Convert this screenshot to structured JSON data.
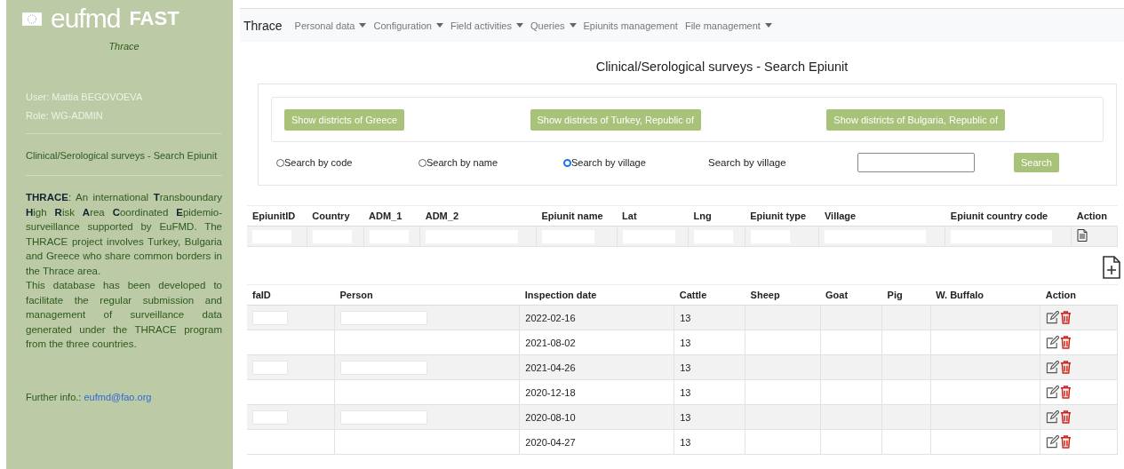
{
  "sidebar": {
    "logo_text": "eufmd",
    "logo_fast": "FAST",
    "subtitle": "Thrace",
    "user": "User: Mattia BEGOVOEVA",
    "role": "Role: WG-ADMIN",
    "current_page": "Clinical/Serological surveys - Search Epiunit",
    "about": [
      "**THRACE**: An international **T**ransboundary **H**igh **R**isk **A**rea **C**oordinated **E**pidemio-surveillance supported by EuFMD. The THRACE project involves Turkey, Bulgaria and Greece who share common borders in the Thrace area.",
      "This database has been developed to facilitate the regular submission and management of surveillance data generated under the THRACE program from the three countries."
    ],
    "further_label": "Further info.:",
    "further_link": "eufmd@fao.org"
  },
  "navbar": {
    "brand": "Thrace",
    "items": [
      {
        "label": "Personal data",
        "dropdown": true
      },
      {
        "label": "Configuration",
        "dropdown": true
      },
      {
        "label": "Field activities",
        "dropdown": true
      },
      {
        "label": "Queries",
        "dropdown": true
      },
      {
        "label": "Epiunits management",
        "dropdown": false
      },
      {
        "label": "File management",
        "dropdown": true
      }
    ]
  },
  "page_title": "Clinical/Serological surveys - Search Epiunit",
  "district_buttons": [
    "Show districts of Greece",
    "Show districts of Turkey, Republic of",
    "Show districts of Bulgaria, Republic of"
  ],
  "search_modes": [
    {
      "label": "Search by code",
      "selected": false
    },
    {
      "label": "Search by name",
      "selected": false
    },
    {
      "label": "Search by village",
      "selected": true
    }
  ],
  "search_label": "Search by village",
  "search_button": "Search",
  "epiunit_table": {
    "columns": [
      "EpiunitID",
      "Country",
      "ADM_1",
      "ADM_2",
      "Epiunit name",
      "Lat",
      "Lng",
      "Epiunit type",
      "Village",
      "Epiunit country code",
      "Action"
    ]
  },
  "visit_table": {
    "columns": [
      "faID",
      "Person",
      "Inspection date",
      "Cattle",
      "Sheep",
      "Goat",
      "Pig",
      "W. Buffalo",
      "Action"
    ],
    "rows": [
      {
        "redacted": true,
        "date": "2022-02-16",
        "cattle": "13"
      },
      {
        "redacted": false,
        "date": "2021-08-02",
        "cattle": "13"
      },
      {
        "redacted": true,
        "date": "2021-04-26",
        "cattle": "13"
      },
      {
        "redacted": false,
        "date": "2020-12-18",
        "cattle": "13"
      },
      {
        "redacted": true,
        "date": "2020-08-10",
        "cattle": "13"
      },
      {
        "redacted": false,
        "date": "2020-04-27",
        "cattle": "13"
      }
    ]
  }
}
